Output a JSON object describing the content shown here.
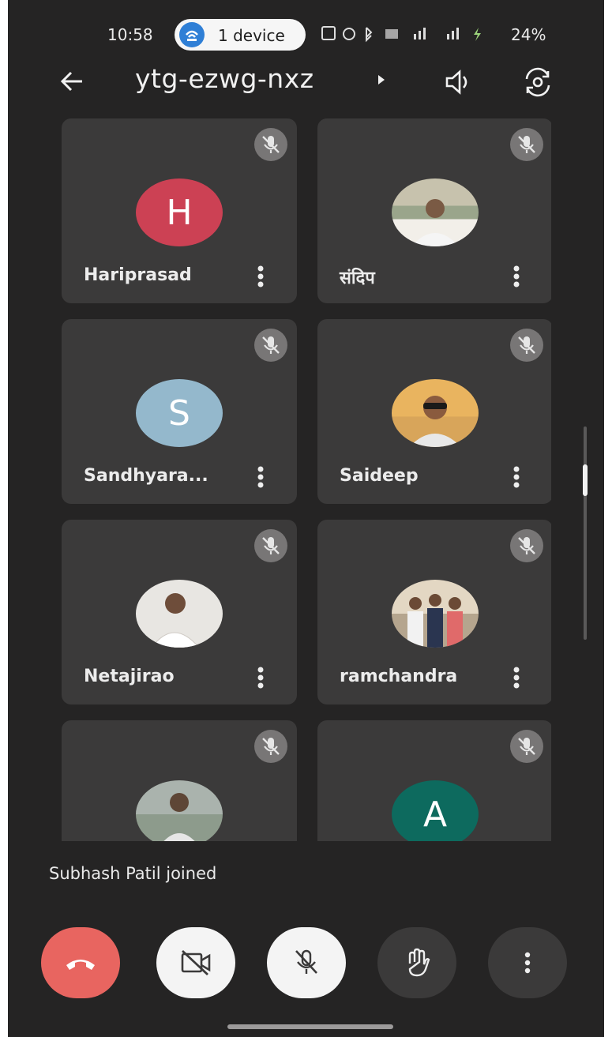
{
  "status_bar": {
    "time": "10:58",
    "device_pill": "1 device",
    "battery": "24%"
  },
  "header": {
    "meeting_code": "ytg-ezwg-nxz"
  },
  "participants": [
    {
      "name": "Hariprasad",
      "avatar_letter": "H",
      "avatar_color": "#cc4154",
      "muted": true
    },
    {
      "name": "संदिप",
      "avatar_letter": "",
      "avatar_color": "#9aa58b",
      "muted": true
    },
    {
      "name": "Sandhyara...",
      "avatar_letter": "S",
      "avatar_color": "#94b8cc",
      "muted": true
    },
    {
      "name": "Saideep",
      "avatar_letter": "",
      "avatar_color": "#d8a55a",
      "muted": true
    },
    {
      "name": "Netajirao",
      "avatar_letter": "",
      "avatar_color": "#cfcac4",
      "muted": true
    },
    {
      "name": "ramchandra",
      "avatar_letter": "",
      "avatar_color": "#b5a58e",
      "muted": true
    },
    {
      "name": "",
      "avatar_letter": "",
      "avatar_color": "#8d9b8c",
      "muted": true
    },
    {
      "name": "",
      "avatar_letter": "A",
      "avatar_color": "#0d6a5e",
      "muted": true
    }
  ],
  "toast": "Subhash Patil joined",
  "colors": {
    "end_call": "#e86560",
    "tile_bg": "#3b3a3a",
    "screen_bg": "#252424"
  }
}
